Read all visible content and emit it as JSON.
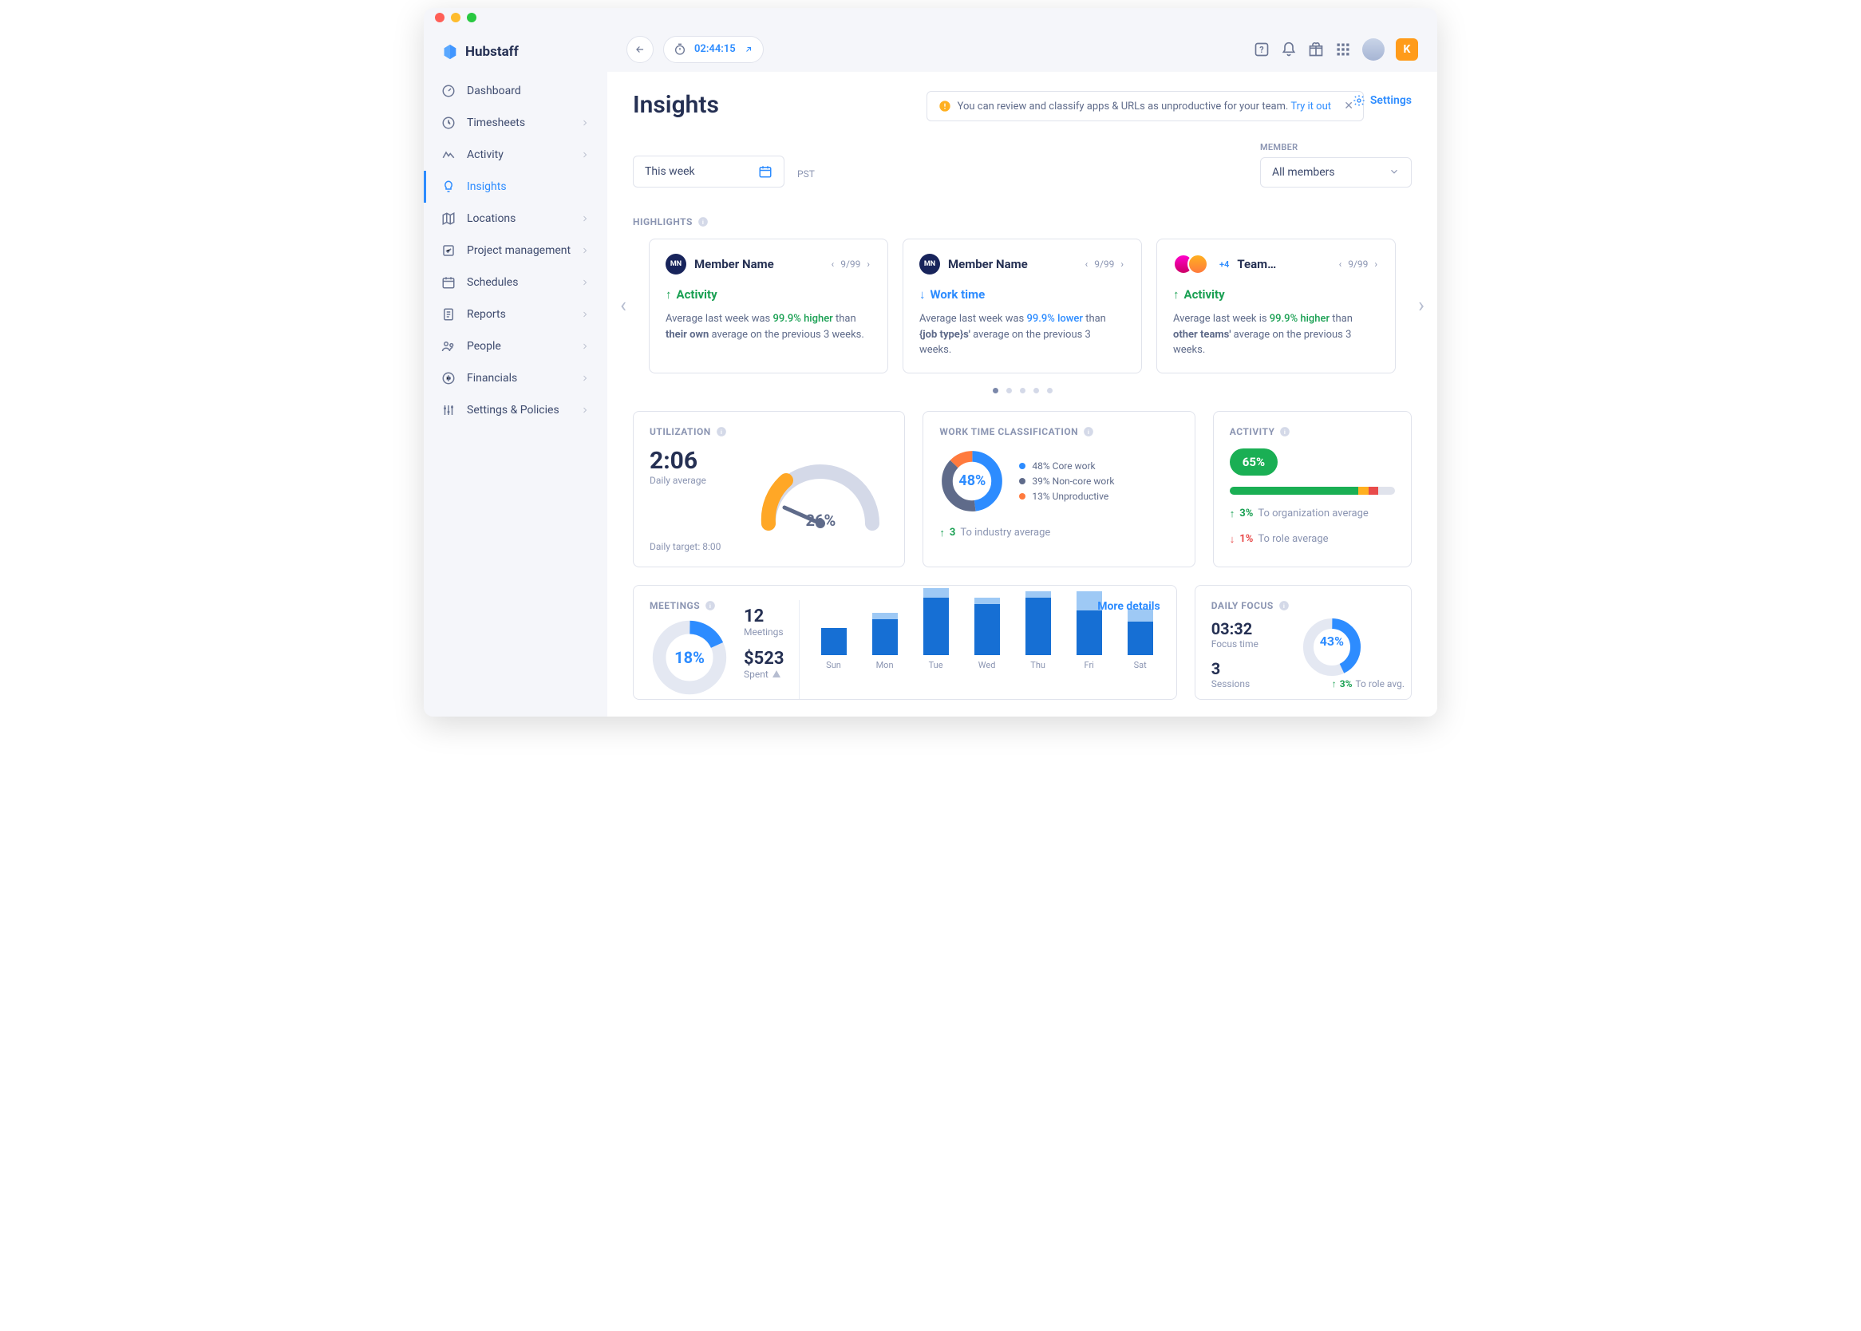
{
  "brand": "Hubstaff",
  "timer": "02:44:15",
  "nav": [
    {
      "label": "Dashboard",
      "chevron": false
    },
    {
      "label": "Timesheets",
      "chevron": true
    },
    {
      "label": "Activity",
      "chevron": true
    },
    {
      "label": "Insights",
      "chevron": false,
      "active": true
    },
    {
      "label": "Locations",
      "chevron": true
    },
    {
      "label": "Project management",
      "chevron": true
    },
    {
      "label": "Schedules",
      "chevron": true
    },
    {
      "label": "Reports",
      "chevron": true
    },
    {
      "label": "People",
      "chevron": true
    },
    {
      "label": "Financials",
      "chevron": true
    },
    {
      "label": "Settings & Policies",
      "chevron": true
    }
  ],
  "avatar_letter": "K",
  "page_title": "Insights",
  "notice_text": "You can review and classify apps & URLs as unproductive for your team. ",
  "notice_link": "Try it out",
  "settings_label": "Settings",
  "date_range": "This week",
  "timezone": "PST",
  "member_label": "MEMBER",
  "member_value": "All members",
  "highlights_label": "HIGHLIGHTS",
  "highlights": [
    {
      "badge": "MN",
      "title": "Member Name",
      "pager": "9/99",
      "metric": "Activity",
      "dir": "up",
      "text_pre": "Average last week was ",
      "pct": "99.9% higher",
      "text_post": " than ",
      "bold": "their own",
      "tail": " average on the previous 3 weeks."
    },
    {
      "badge": "MN",
      "title": "Member Name",
      "pager": "9/99",
      "metric": "Work time",
      "dir": "down",
      "text_pre": "Average last week was ",
      "pct": "99.9% lower",
      "text_post": " than ",
      "bold": "{job type}s'",
      "tail": " average on the previous 3 weeks."
    },
    {
      "badge": "team",
      "title": "Team…",
      "plus": "+4",
      "pager": "9/99",
      "metric": "Activity",
      "dir": "up",
      "text_pre": "Average last week is ",
      "pct": "99.9% higher",
      "text_post": " than ",
      "bold": "other teams'",
      "tail": " average on the previous 3 weeks."
    }
  ],
  "util": {
    "title": "UTILIZATION",
    "value": "2:06",
    "sub": "Daily average",
    "target": "Daily target: 8:00",
    "pct": "26%"
  },
  "wtc": {
    "title": "WORK TIME CLASSIFICATION",
    "center": "48%",
    "legend": [
      {
        "pct": "48%",
        "label": "Core work",
        "color": "#2d8cff"
      },
      {
        "pct": "39%",
        "label": "Non-core work",
        "color": "#5f6b8a"
      },
      {
        "pct": "13%",
        "label": "Unproductive",
        "color": "#ff7a3d"
      }
    ],
    "compare_val": "3",
    "compare_label": "To industry average"
  },
  "activity": {
    "title": "ACTIVITY",
    "pill": "65%",
    "compares": [
      {
        "dir": "up",
        "val": "3%",
        "label": "To organization average"
      },
      {
        "dir": "down",
        "val": "1%",
        "label": "To role average"
      }
    ]
  },
  "meetings": {
    "title": "MEETINGS",
    "donut": "18%",
    "more": "More details",
    "stats": [
      {
        "v": "12",
        "l": "Meetings"
      },
      {
        "v": "$523",
        "l": "Spent",
        "warn": true
      }
    ]
  },
  "focus": {
    "title": "DAILY FOCUS",
    "focus_time": "03:32",
    "focus_label": "Focus time",
    "sessions": "3",
    "sessions_label": "Sessions",
    "donut": "43%",
    "compare_val": "3%",
    "compare_label": "To role avg."
  },
  "chart_data": {
    "type": "bar",
    "categories": [
      "Sun",
      "Mon",
      "Tue",
      "Wed",
      "Thu",
      "Fri",
      "Sat"
    ],
    "series": [
      {
        "name": "primary",
        "values": [
          34,
          45,
          72,
          64,
          72,
          56,
          42
        ]
      },
      {
        "name": "secondary",
        "values": [
          0,
          8,
          12,
          8,
          8,
          24,
          16
        ]
      }
    ],
    "ylim": [
      0,
      90
    ]
  }
}
